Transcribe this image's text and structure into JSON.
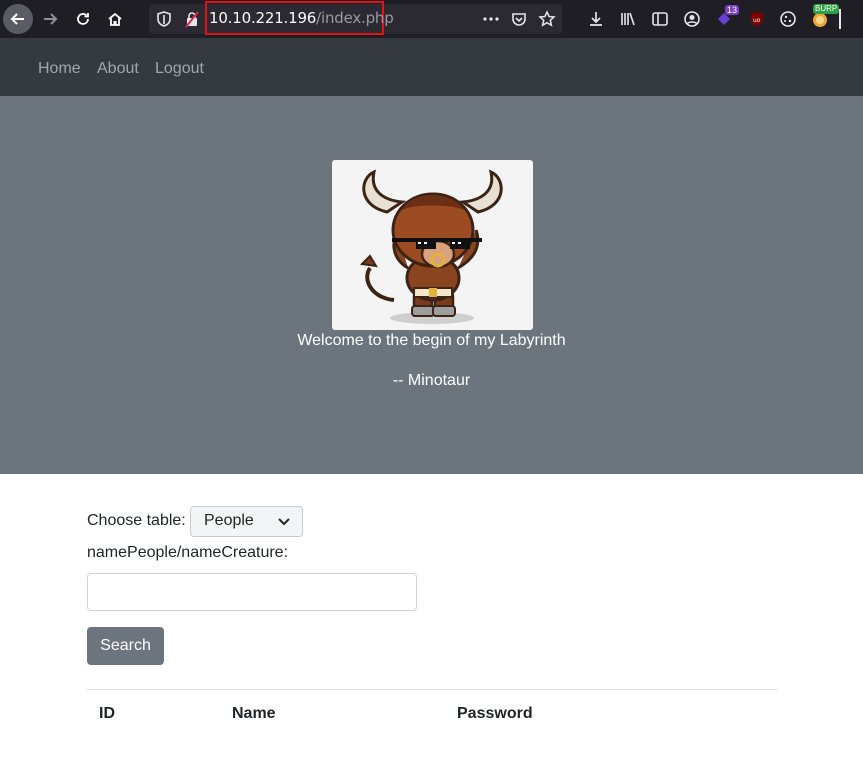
{
  "browser": {
    "url_host": "10.10.221.196",
    "url_path": "/index.php",
    "extension_badge": "13",
    "burp_badge": "BURP"
  },
  "nav": {
    "links": [
      "Home",
      "About",
      "Logout"
    ]
  },
  "hero": {
    "image": "minotaur-mascot",
    "welcome": "Welcome to the begin of my Labyrinth",
    "signature": "-- Minotaur"
  },
  "form": {
    "choose_label": "Choose table:",
    "table_selected": "People",
    "field_label": "namePeople/nameCreature:",
    "field_value": "",
    "search_label": "Search"
  },
  "table": {
    "headers": [
      "ID",
      "Name",
      "Password"
    ]
  },
  "colors": {
    "navbar": "#343a40",
    "hero": "#6c757d",
    "button": "#6c757d",
    "url_highlight": "#e11515"
  }
}
